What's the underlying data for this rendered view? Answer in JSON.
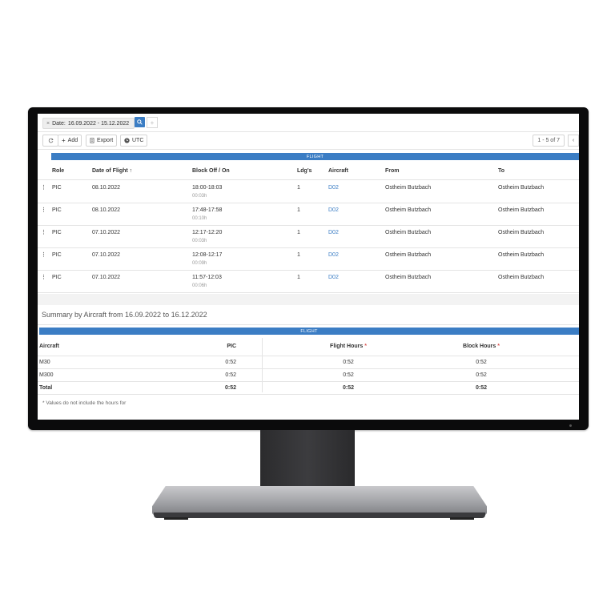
{
  "filter": {
    "chip_close": "×",
    "chip_label": "Date:",
    "chip_value": "16.09.2022 - 15.12.2022"
  },
  "toolbar": {
    "refresh_icon": "refresh-icon",
    "add_label": "Add",
    "export_label": "Export",
    "utc_label": "UTC",
    "pager_text": "1 - 5 of 7"
  },
  "flights": {
    "group_header": "FLIGHT",
    "columns": {
      "role": "Role",
      "date": "Date of Flight",
      "block": "Block Off / On",
      "ldgs": "Ldg's",
      "aircraft": "Aircraft",
      "from": "From",
      "to": "To"
    },
    "rows": [
      {
        "role": "PIC",
        "date": "08.10.2022",
        "block": "18:00-18:03",
        "duration": "00:03h",
        "ldgs": "1",
        "aircraft": "D02",
        "from": "Ostheim Butzbach",
        "to": "Ostheim Butzbach"
      },
      {
        "role": "PIC",
        "date": "08.10.2022",
        "block": "17:48-17:58",
        "duration": "00:10h",
        "ldgs": "1",
        "aircraft": "D02",
        "from": "Ostheim Butzbach",
        "to": "Ostheim Butzbach"
      },
      {
        "role": "PIC",
        "date": "07.10.2022",
        "block": "12:17-12:20",
        "duration": "00:03h",
        "ldgs": "1",
        "aircraft": "D02",
        "from": "Ostheim Butzbach",
        "to": "Ostheim Butzbach"
      },
      {
        "role": "PIC",
        "date": "07.10.2022",
        "block": "12:08-12:17",
        "duration": "00:09h",
        "ldgs": "1",
        "aircraft": "D02",
        "from": "Ostheim Butzbach",
        "to": "Ostheim Butzbach"
      },
      {
        "role": "PIC",
        "date": "07.10.2022",
        "block": "11:57-12:03",
        "duration": "00:06h",
        "ldgs": "1",
        "aircraft": "D02",
        "from": "Ostheim Butzbach",
        "to": "Ostheim Butzbach"
      }
    ]
  },
  "summary": {
    "title": "Summary by Aircraft from 16.09.2022 to 16.12.2022",
    "group_header": "FLIGHT",
    "columns": {
      "aircraft": "Aircraft",
      "pic": "PIC",
      "flight_hours": "Flight Hours",
      "block_hours": "Block Hours",
      "required_mark": "*"
    },
    "rows": [
      {
        "aircraft": "M30",
        "pic": "0:52",
        "flight_hours": "0:52",
        "block_hours": "0:52"
      },
      {
        "aircraft": "M300",
        "pic": "0:52",
        "flight_hours": "0:52",
        "block_hours": "0:52"
      }
    ],
    "total": {
      "aircraft": "Total",
      "pic": "0:52",
      "flight_hours": "0:52",
      "block_hours": "0:52"
    },
    "footnote": "* Values do not include the hours for"
  },
  "colors": {
    "accent": "#3b7dc4",
    "required": "#d9534f"
  }
}
